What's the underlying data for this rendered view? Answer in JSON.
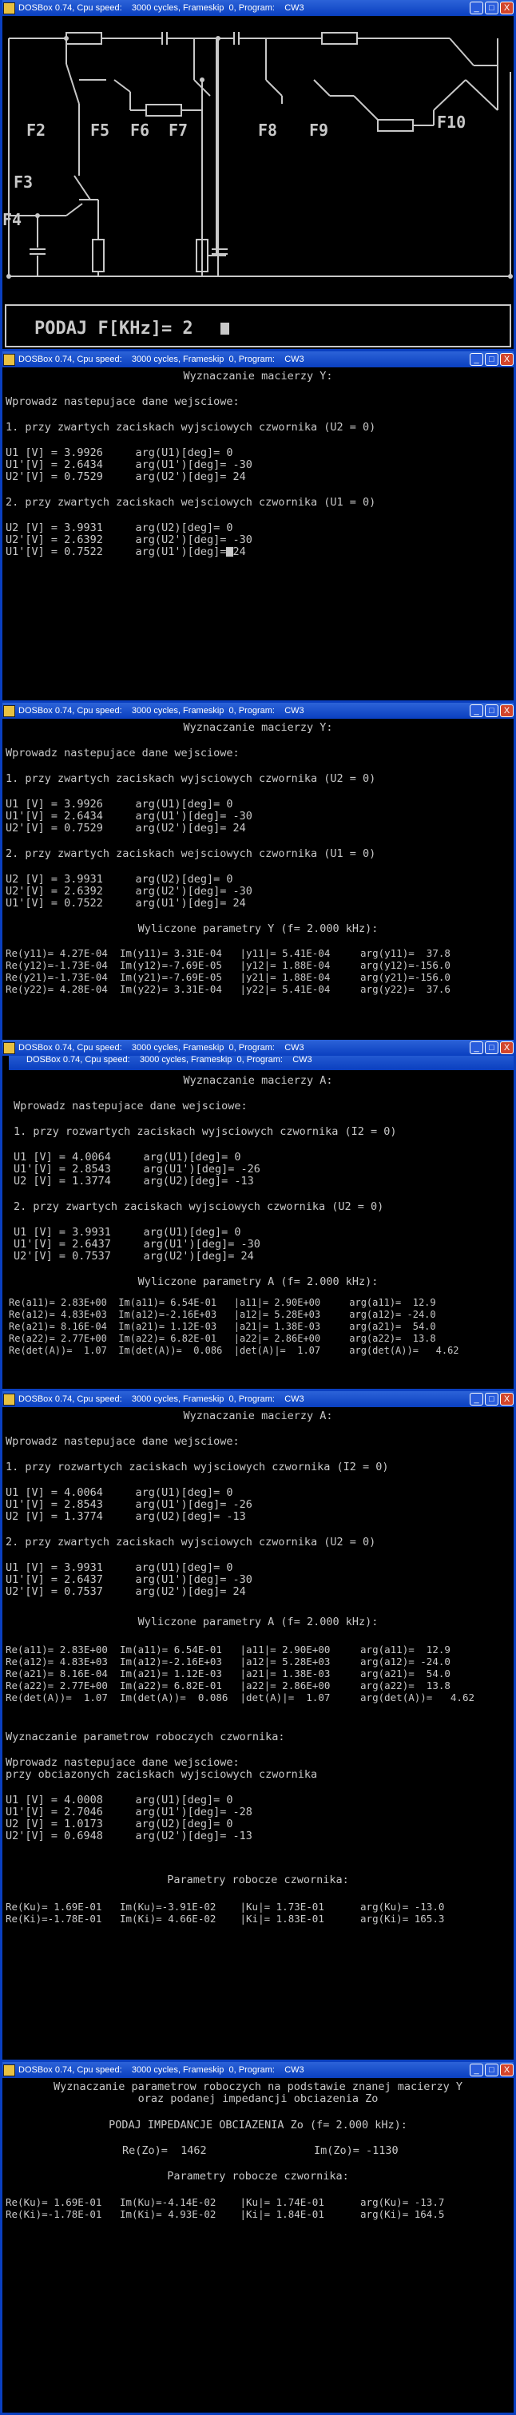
{
  "window_title": "DOSBox 0.74, Cpu speed:    3000 cycles, Frameskip  0, Program:    CW3",
  "window_buttons": {
    "minimize": "_",
    "maximize": "□",
    "close": "X"
  },
  "circuit": {
    "labels": [
      "F2",
      "F5",
      "F6",
      "F7",
      "F8",
      "F9",
      "F10",
      "F3",
      "F4"
    ],
    "prompt": "PODAJ F[KHz]= 2"
  },
  "screen2": {
    "lines": [
      "Wyznaczanie macierzy Y:",
      "Wprowadz nastepujace dane wejsciowe:",
      "1. przy zwartych zaciskach wyjsciowych czwornika (U2 = 0)",
      "U1 [V] = 3.9926     arg(U1)[deg]= 0",
      "U1'[V] = 2.6434     arg(U1')[deg]= -30",
      "U2'[V] = 0.7529     arg(U2')[deg]= 24",
      "2. przy zwartych zaciskach wejsciowych czwornika (U1 = 0)",
      "U2 [V] = 3.9931     arg(U2)[deg]= 0",
      "U2'[V] = 2.6392     arg(U2')[deg]= -30",
      "U1'[V] = 0.7522     arg(U1')[deg]= 24"
    ]
  },
  "screen3": {
    "lines": [
      "Wyznaczanie macierzy Y:",
      "Wprowadz nastepujace dane wejsciowe:",
      "1. przy zwartych zaciskach wyjsciowych czwornika (U2 = 0)",
      "U1 [V] = 3.9926     arg(U1)[deg]= 0",
      "U1'[V] = 2.6434     arg(U1')[deg]= -30",
      "U2'[V] = 0.7529     arg(U2')[deg]= 24",
      "2. przy zwartych zaciskach wejsciowych czwornika (U1 = 0)",
      "U2 [V] = 3.9931     arg(U2)[deg]= 0",
      "U2'[V] = 2.6392     arg(U2')[deg]= -30",
      "U1'[V] = 0.7522     arg(U1')[deg]= 24",
      "Wyliczone parametry Y (f= 2.000 kHz):",
      "Re(y11)= 4.27E-04  Im(y11)= 3.31E-04   |y11|= 5.41E-04     arg(y11)=  37.8",
      "Re(y12)=-1.73E-04  Im(y12)=-7.69E-05   |y12|= 1.88E-04     arg(y12)=-156.0",
      "Re(y21)=-1.73E-04  Im(y21)=-7.69E-05   |y21|= 1.88E-04     arg(y21)=-156.0",
      "Re(y22)= 4.28E-04  Im(y22)= 3.31E-04   |y22|= 5.41E-04     arg(y22)=  37.6"
    ]
  },
  "screen4": {
    "lines": [
      "Wyznaczanie macierzy A:",
      "Wprowadz nastepujace dane wejsciowe:",
      "1. przy rozwartych zaciskach wyjsciowych czwornika (I2 = 0)",
      "U1 [V] = 4.0064     arg(U1)[deg]= 0",
      "U1'[V] = 2.8543     arg(U1')[deg]= -26",
      "U2 [V] = 1.3774     arg(U2)[deg]= -13",
      "2. przy zwartych zaciskach wyjsciowych czwornika (U2 = 0)",
      "U1 [V] = 3.9931     arg(U1)[deg]= 0",
      "U1'[V] = 2.6437     arg(U1')[deg]= -30",
      "U2'[V] = 0.7537     arg(U2')[deg]= 24",
      "Wyliczone parametry A (f= 2.000 kHz):",
      "Re(a11)= 2.83E+00  Im(a11)= 6.54E-01   |a11|= 2.90E+00     arg(a11)=  12.9",
      "Re(a12)= 4.83E+03  Im(a12)=-2.16E+03   |a12|= 5.28E+03     arg(a12)= -24.0",
      "Re(a21)= 8.16E-04  Im(a21)= 1.12E-03   |a21|= 1.38E-03     arg(a21)=  54.0",
      "Re(a22)= 2.77E+00  Im(a22)= 6.82E-01   |a22|= 2.86E+00     arg(a22)=  13.8",
      "Re(det(A))=  1.07  Im(det(A))=  0.086  |det(A)|=  1.07     arg(det(A))=   4.62"
    ]
  },
  "screen5": {
    "lines": [
      "Wyznaczanie macierzy A:",
      "Wprowadz nastepujace dane wejsciowe:",
      "1. przy rozwartych zaciskach wyjsciowych czwornika (I2 = 0)",
      "U1 [V] = 4.0064     arg(U1)[deg]= 0",
      "U1'[V] = 2.8543     arg(U1')[deg]= -26",
      "U2 [V] = 1.3774     arg(U2)[deg]= -13",
      "2. przy zwartych zaciskach wyjsciowych czwornika (U2 = 0)",
      "U1 [V] = 3.9931     arg(U1)[deg]= 0",
      "U1'[V] = 2.6437     arg(U1')[deg]= -30",
      "U2'[V] = 0.7537     arg(U2')[deg]= 24",
      "Wyliczone parametry A (f= 2.000 kHz):",
      "Re(a11)= 2.83E+00  Im(a11)= 6.54E-01   |a11|= 2.90E+00     arg(a11)=  12.9",
      "Re(a12)= 4.83E+03  Im(a12)=-2.16E+03   |a12|= 5.28E+03     arg(a12)= -24.0",
      "Re(a21)= 8.16E-04  Im(a21)= 1.12E-03   |a21|= 1.38E-03     arg(a21)=  54.0",
      "Re(a22)= 2.77E+00  Im(a22)= 6.82E-01   |a22|= 2.86E+00     arg(a22)=  13.8",
      "Re(det(A))=  1.07  Im(det(A))=  0.086  |det(A)|=  1.07     arg(det(A))=   4.62"
    ]
  },
  "screen6": {
    "lines": [
      "Wyznaczanie parametrow roboczych czwornika:",
      "Wprowadz nastepujace dane wejsciowe:",
      "przy obciazonych zaciskach wyjsciowych czwornika",
      "U1 [V] = 4.0008     arg(U1)[deg]= 0",
      "U1'[V] = 2.7046     arg(U1')[deg]= -28",
      "U2 [V] = 1.0173     arg(U2)[deg]= 0",
      "U2'[V] = 0.6948     arg(U2')[deg]= -13",
      "Parametry robocze czwornika:",
      "Re(Ku)= 1.69E-01   Im(Ku)=-3.91E-02    |Ku|= 1.73E-01      arg(Ku)= -13.0",
      "Re(Ki)=-1.78E-01   Im(Ki)= 4.66E-02    |Ki|= 1.83E-01      arg(Ki)= 165.3"
    ]
  },
  "screen7": {
    "lines": [
      "Wyznaczanie parametrow roboczych na podstawie znanej macierzy Y",
      "oraz podanej impedancji obciazenia Zo",
      "PODAJ IMPEDANCJE OBCIAZENIA Zo (f= 2.000 kHz):",
      "Re(Zo)=  1462",
      "Im(Zo)= -1130",
      "Parametry robocze czwornika:",
      "Re(Ku)= 1.69E-01   Im(Ku)=-4.14E-02    |Ku|= 1.74E-01      arg(Ku)= -13.7",
      "Re(Ki)=-1.78E-01   Im(Ki)= 4.93E-02    |Ki|= 1.84E-01      arg(Ki)= 164.5"
    ]
  }
}
